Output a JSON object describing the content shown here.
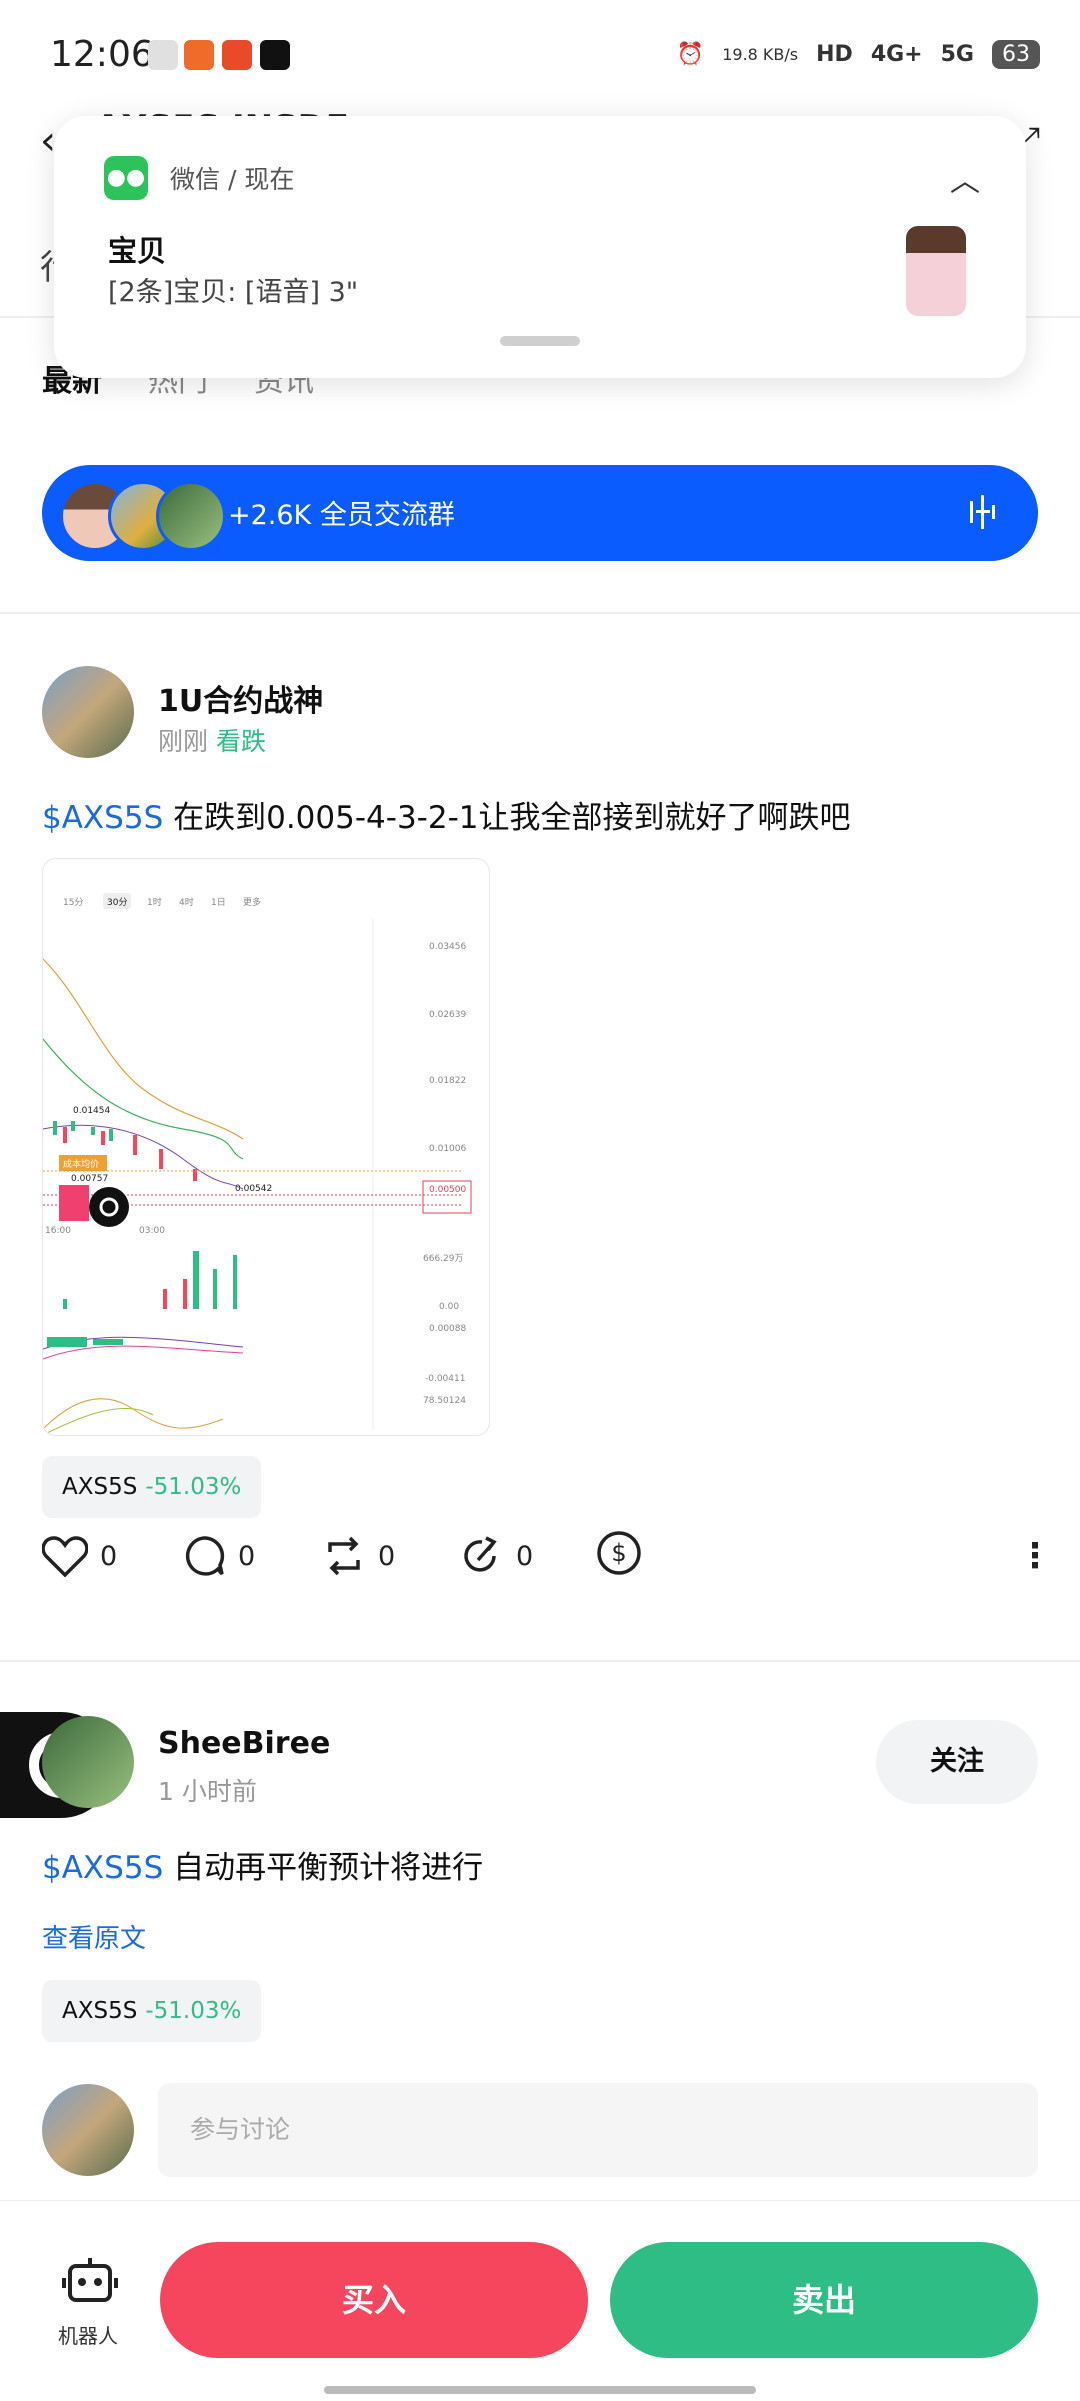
{
  "status_bar": {
    "time": "12:06",
    "net_speed": "19.8 KB/s",
    "hd": "HD",
    "net1": "4G+",
    "net2": "5G",
    "battery": "63"
  },
  "header": {
    "title": "AXS5S INSDE",
    "tabs_partial": "行"
  },
  "subtabs": [
    {
      "label": "最新",
      "active": true
    },
    {
      "label": "热门",
      "active": false
    },
    {
      "label": "资讯",
      "active": false
    }
  ],
  "notification": {
    "source": "微信 / 现在",
    "title": "宝贝",
    "body": "[2条]宝贝: [语音] 3\""
  },
  "group_banner": {
    "text": "+2.6K  全员交流群"
  },
  "post1": {
    "username": "1U合约战神",
    "time": "刚刚",
    "sentiment": "看跌",
    "tag": "$AXS5S",
    "text": " 在跌到0.005-4-3-2-1让我全部接到就好了啊跌吧",
    "chip_symbol": "AXS5S",
    "chip_change": "-51.03%",
    "likes": "0",
    "comments": "0",
    "reposts": "0",
    "shares": "0",
    "chart": {
      "tabs": [
        "15分",
        "30分",
        "1时",
        "4时",
        "1日",
        "更多"
      ],
      "price_labels": [
        "0.03456",
        "0.02639",
        "0.01822",
        "0.01006",
        "0.00500"
      ],
      "markers": [
        "0.01454",
        "0.00757",
        "0.00542"
      ],
      "time_labels": [
        "16:00",
        "03:00"
      ],
      "vol_labels": [
        "666.29万",
        "0.00"
      ],
      "macd_labels": [
        "0.00088",
        "-0.00411",
        "78.50124"
      ],
      "cost_label": "成本均价"
    }
  },
  "post2": {
    "username": "SheeBiree",
    "time": "1 小时前",
    "follow_label": "关注",
    "tag": "$AXS5S",
    "text": " 自动再平衡预计将进行",
    "view_original": "查看原文",
    "chip_symbol": "AXS5S",
    "chip_change": "-51.03%"
  },
  "comment_input": {
    "placeholder": "参与讨论"
  },
  "bottom_bar": {
    "robot_label": "机器人",
    "buy_label": "买入",
    "sell_label": "卖出"
  },
  "colors": {
    "banner_blue": "#0a5cff",
    "buy_red": "#f6465d",
    "sell_green": "#2ebd85",
    "link_blue": "#1a6be0"
  }
}
